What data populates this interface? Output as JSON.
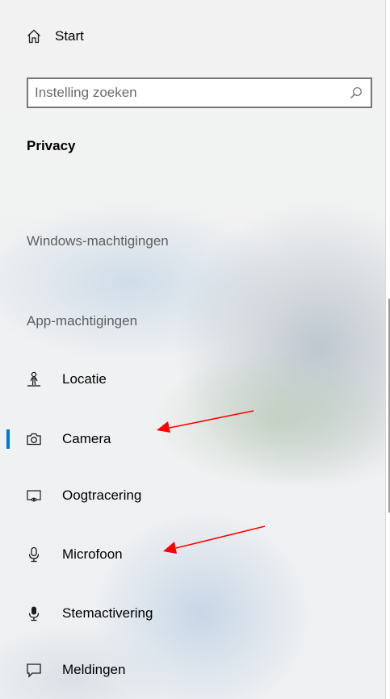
{
  "nav": {
    "home_label": "Start"
  },
  "search": {
    "placeholder": "Instelling zoeken"
  },
  "section": {
    "title": "Privacy"
  },
  "groups": {
    "windows_permissions": "Windows-machtigingen",
    "app_permissions": "App-machtigingen"
  },
  "items": [
    {
      "label": "Locatie",
      "icon": "location-person-icon",
      "selected": false
    },
    {
      "label": "Camera",
      "icon": "camera-icon",
      "selected": true
    },
    {
      "label": "Oogtracering",
      "icon": "eye-tracking-icon",
      "selected": false
    },
    {
      "label": "Microfoon",
      "icon": "microphone-icon",
      "selected": false
    },
    {
      "label": "Stemactivering",
      "icon": "voice-activation-icon",
      "selected": false
    },
    {
      "label": "Meldingen",
      "icon": "notification-icon",
      "selected": false
    }
  ],
  "colors": {
    "accent": "#0078d7",
    "annotation_arrow": "#ff0000"
  }
}
